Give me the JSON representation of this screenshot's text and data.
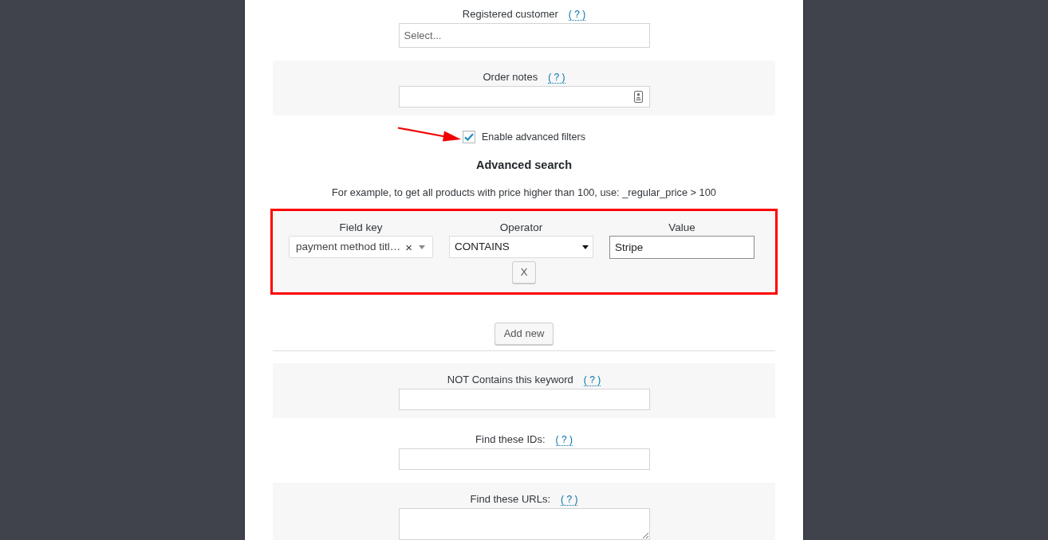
{
  "form": [
    {
      "kind": "select",
      "label": "Registered customer",
      "help": "( ? )",
      "placeholder": "Select..."
    },
    {
      "kind": "iconinput",
      "label": "Order notes",
      "help": "( ? )"
    },
    {
      "kind": "advanced",
      "toggle": {
        "label": "Enable advanced filters",
        "checked": true,
        "arrow": true
      },
      "title": "Advanced search",
      "hint": "For example, to get all products with price higher than 100, use: _regular_price > 100",
      "filters": [
        {
          "highlighted": true,
          "field_key": {
            "label": "Field key",
            "value": "payment method titl…",
            "clear": "×"
          },
          "operator": {
            "label": "Operator",
            "value": "CONTAINS"
          },
          "value": {
            "label": "Value",
            "value": "Stripe"
          },
          "remove": "X"
        }
      ],
      "add_button": "Add new"
    },
    {
      "kind": "input",
      "label": "NOT Contains this keyword",
      "help": "( ? )"
    },
    {
      "kind": "input",
      "label": "Find these IDs:",
      "help": "( ? )"
    },
    {
      "kind": "textarea",
      "label": "Find these URLs:",
      "help": "( ? )"
    }
  ]
}
